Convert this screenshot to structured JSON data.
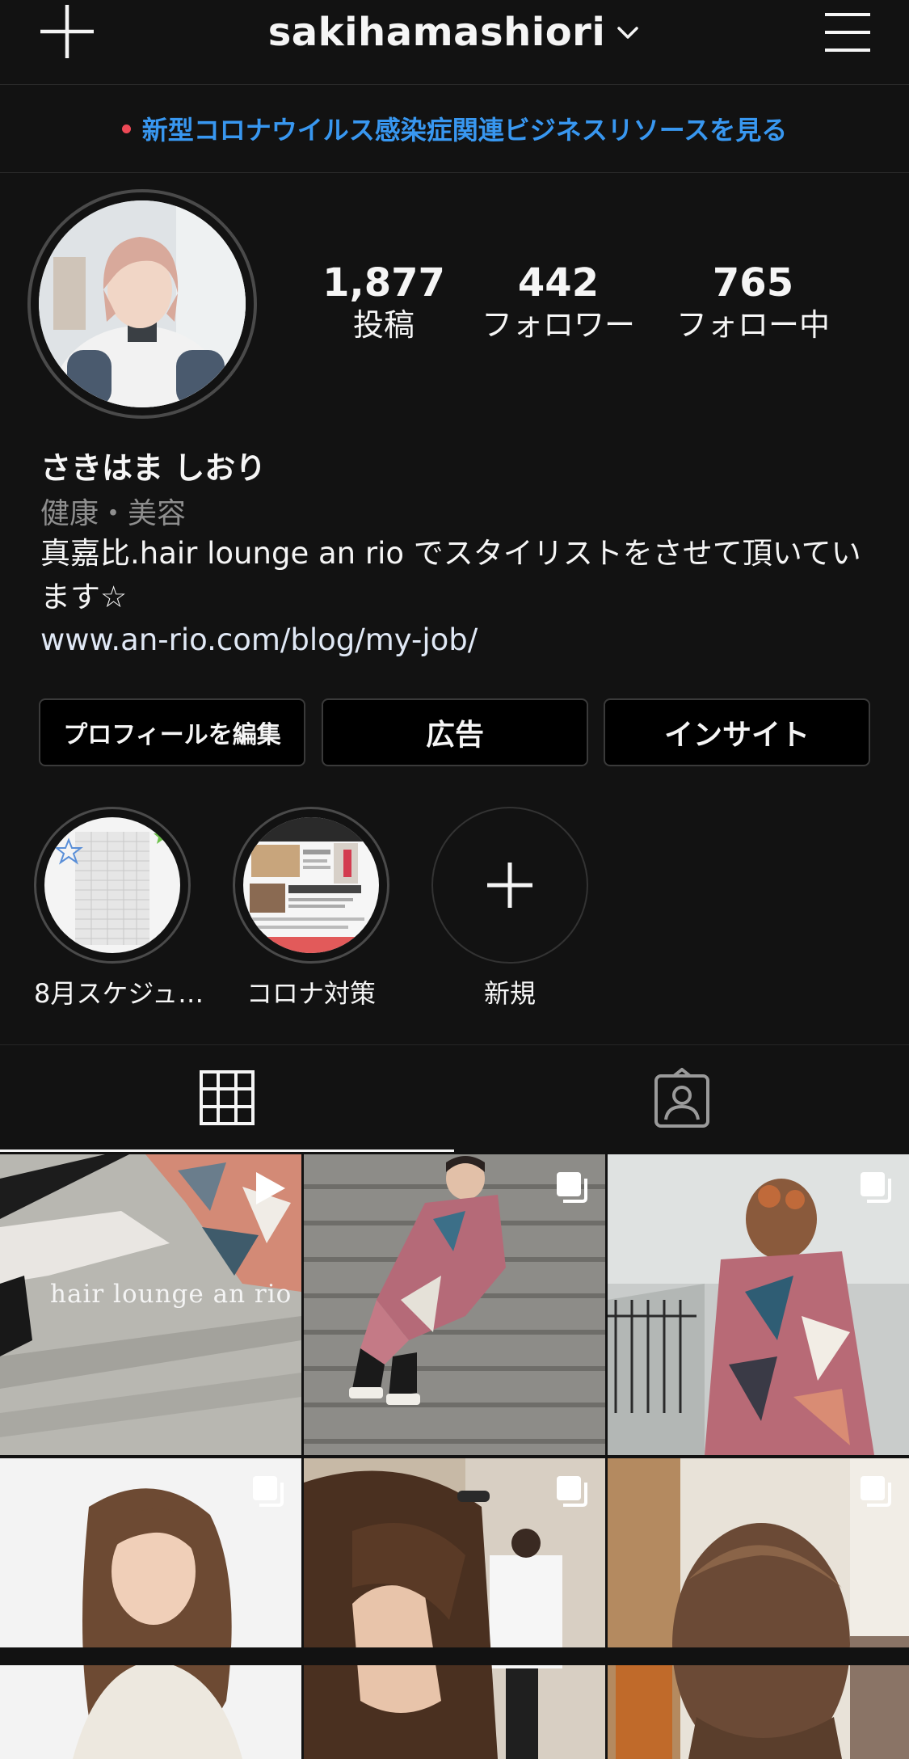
{
  "header": {
    "username": "sakihamashiori",
    "new_post_icon": "plus-icon",
    "dropdown_icon": "chevron-down-icon",
    "menu_icon": "hamburger-menu-icon"
  },
  "banner": {
    "text": "新型コロナウイルス感染症関連ビジネスリソースを見る",
    "link_color": "#3897f0",
    "dot_color": "#ed4956"
  },
  "profile": {
    "stats": [
      {
        "value": "1,877",
        "label": "投稿"
      },
      {
        "value": "442",
        "label": "フォロワー"
      },
      {
        "value": "765",
        "label": "フォロー中"
      }
    ],
    "name": "さきはま しおり",
    "category": "健康・美容",
    "bio": "真嘉比.hair lounge an rio でスタイリストをさせて頂いています☆",
    "website": "www.an-rio.com/blog/my-job/"
  },
  "buttons": {
    "edit_profile": "プロフィールを編集",
    "promotions": "広告",
    "insights": "インサイト"
  },
  "highlights": [
    {
      "label": "8月スケジュ…"
    },
    {
      "label": "コロナ対策"
    },
    {
      "label": "新規"
    }
  ],
  "tabs": {
    "grid_icon": "grid-icon",
    "tagged_icon": "tagged-person-icon"
  },
  "posts": [
    {
      "type": "video",
      "overlay_text": "hair lounge an rio",
      "icon": "play-icon"
    },
    {
      "type": "carousel",
      "icon": "carousel-icon"
    },
    {
      "type": "carousel",
      "icon": "carousel-icon"
    },
    {
      "type": "carousel",
      "icon": "carousel-icon"
    },
    {
      "type": "carousel",
      "icon": "carousel-icon"
    },
    {
      "type": "carousel",
      "icon": "carousel-icon"
    }
  ]
}
